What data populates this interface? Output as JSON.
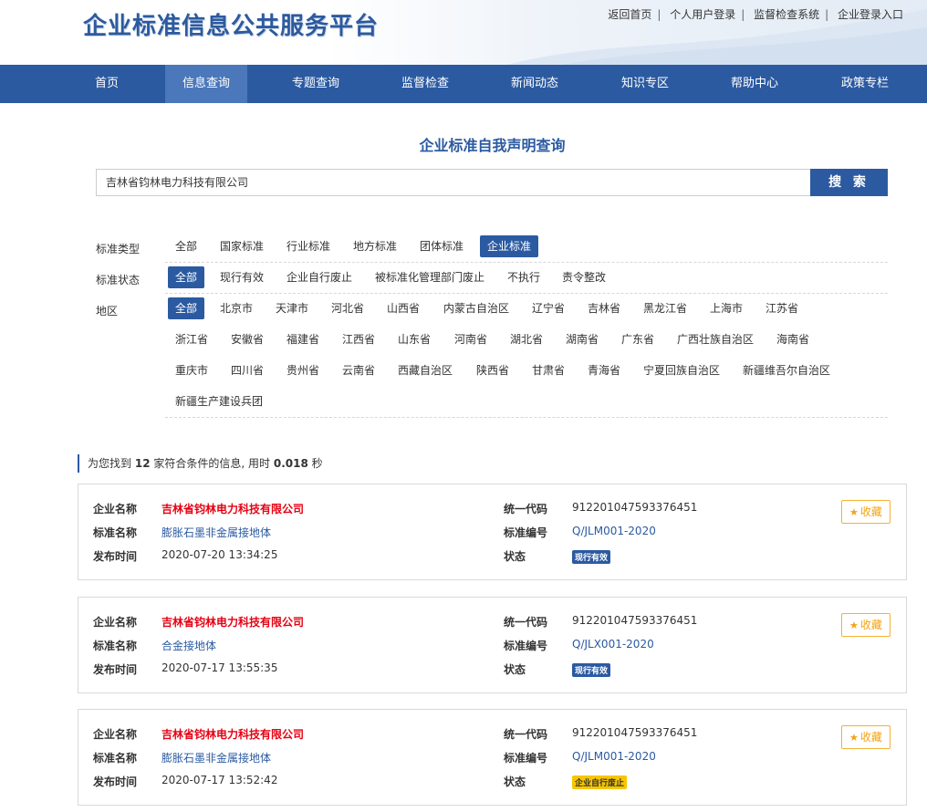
{
  "header": {
    "title": "企业标准信息公共服务平台",
    "top_links": [
      "返回首页",
      "个人用户登录",
      "监督检查系统",
      "企业登录入口"
    ]
  },
  "nav": {
    "items": [
      "首页",
      "信息查询",
      "专题查询",
      "监督检查",
      "新闻动态",
      "知识专区",
      "帮助中心",
      "政策专栏"
    ],
    "active": "信息查询"
  },
  "search": {
    "heading": "企业标准自我声明查询",
    "value": "吉林省钧林电力科技有限公司",
    "button_label": "搜 索"
  },
  "filters": {
    "standard_type": {
      "label": "标准类型",
      "options": [
        "全部",
        "国家标准",
        "行业标准",
        "地方标准",
        "团体标准",
        "企业标准"
      ],
      "selected": "企业标准"
    },
    "standard_status": {
      "label": "标准状态",
      "options": [
        "全部",
        "现行有效",
        "企业自行废止",
        "被标准化管理部门废止",
        "不执行",
        "责令整改"
      ],
      "selected": "全部"
    },
    "region": {
      "label": "地区",
      "options": [
        "全部",
        "北京市",
        "天津市",
        "河北省",
        "山西省",
        "内蒙古自治区",
        "辽宁省",
        "吉林省",
        "黑龙江省",
        "上海市",
        "江苏省",
        "浙江省",
        "安徽省",
        "福建省",
        "江西省",
        "山东省",
        "河南省",
        "湖北省",
        "湖南省",
        "广东省",
        "广西壮族自治区",
        "海南省",
        "重庆市",
        "四川省",
        "贵州省",
        "云南省",
        "西藏自治区",
        "陕西省",
        "甘肃省",
        "青海省",
        "宁夏回族自治区",
        "新疆维吾尔自治区",
        "新疆生产建设兵团"
      ],
      "selected": "全部"
    }
  },
  "summary": {
    "prefix": "为您找到",
    "count": "12",
    "middle": "家符合条件的信息, 用时",
    "time": "0.018",
    "suffix": "秒"
  },
  "labels": {
    "company": "企业名称",
    "standard_name": "标准名称",
    "publish_time": "发布时间",
    "credit_code": "统一代码",
    "standard_no": "标准编号",
    "status": "状态",
    "favorite": "收藏"
  },
  "results": [
    {
      "company": "吉林省钧林电力科技有限公司",
      "standard_name": "膨胀石墨非金属接地体",
      "publish_time": "2020-07-20 13:34:25",
      "credit_code": "912201047593376451",
      "standard_no": "Q/JLM001-2020",
      "status": "现行有效"
    },
    {
      "company": "吉林省钧林电力科技有限公司",
      "standard_name": "合金接地体",
      "publish_time": "2020-07-17 13:55:35",
      "credit_code": "912201047593376451",
      "standard_no": "Q/JLX001-2020",
      "status": "现行有效"
    },
    {
      "company": "吉林省钧林电力科技有限公司",
      "standard_name": "膨胀石墨非金属接地体",
      "publish_time": "2020-07-17 13:52:42",
      "credit_code": "912201047593376451",
      "standard_no": "Q/JLM001-2020",
      "status": "企业自行废止"
    }
  ],
  "colors": {
    "primary": "#2b5aa1",
    "company_red": "#e60012",
    "favorite_orange": "#f3a312",
    "abolished_yellow": "#f7c600"
  }
}
